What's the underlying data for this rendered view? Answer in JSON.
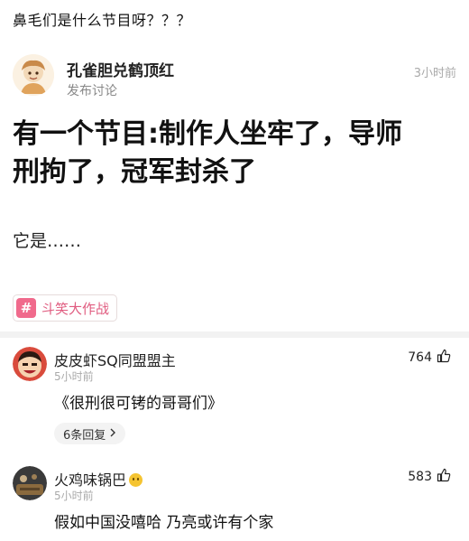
{
  "caption": "鼻毛们是什么节目呀？？？",
  "post": {
    "author": "孔雀胆兑鹤顶红",
    "action": "发布讨论",
    "time": "3小时前",
    "body_lines": [
      "有一个节目:制作人坐牢了，导师",
      "刑拘了，冠军封杀了"
    ],
    "body_second": "它是……",
    "tag_icon": "#",
    "tag_label": "斗笑大作战"
  },
  "comments": [
    {
      "name": "皮皮虾SQ同盟盟主",
      "time": "5小时前",
      "likes": "764",
      "text": "《很刑很可铐的哥哥们》",
      "replies_label": "6条回复"
    },
    {
      "name": "火鸡味锅巴",
      "time": "5小时前",
      "likes": "583",
      "text": "假如中国没嘻哈 乃亮或许有个家"
    }
  ],
  "colors": {
    "tag_accent": "#e05b7f",
    "divider": "#f2f2f2",
    "meta_gray": "#aaaaaa"
  },
  "icons": {
    "like": "thumbs-up-icon",
    "chevron": "chevron-right-icon",
    "tag": "hashtag-icon"
  }
}
